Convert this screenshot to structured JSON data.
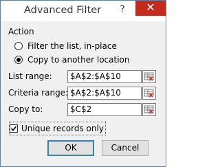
{
  "window": {
    "title": "Advanced Filter",
    "help_label": "?",
    "close_label": "✕"
  },
  "action": {
    "group_label": "Action",
    "options": [
      {
        "label": "Filter the list, in-place",
        "checked": false
      },
      {
        "label": "Copy to another location",
        "checked": true
      }
    ]
  },
  "fields": {
    "list_range": {
      "label": "List range:",
      "value": "$A$2:$A$10"
    },
    "criteria_range": {
      "label": "Criteria range:",
      "value": "$A$2:$A$10"
    },
    "copy_to": {
      "label": "Copy to:",
      "value": "$C$2"
    }
  },
  "unique_records": {
    "label": "Unique records only",
    "checked": true
  },
  "buttons": {
    "ok": "OK",
    "cancel": "Cancel"
  },
  "icons": {
    "range_selector": "range-select-icon",
    "excel_logo": "excel-logo-icon"
  }
}
